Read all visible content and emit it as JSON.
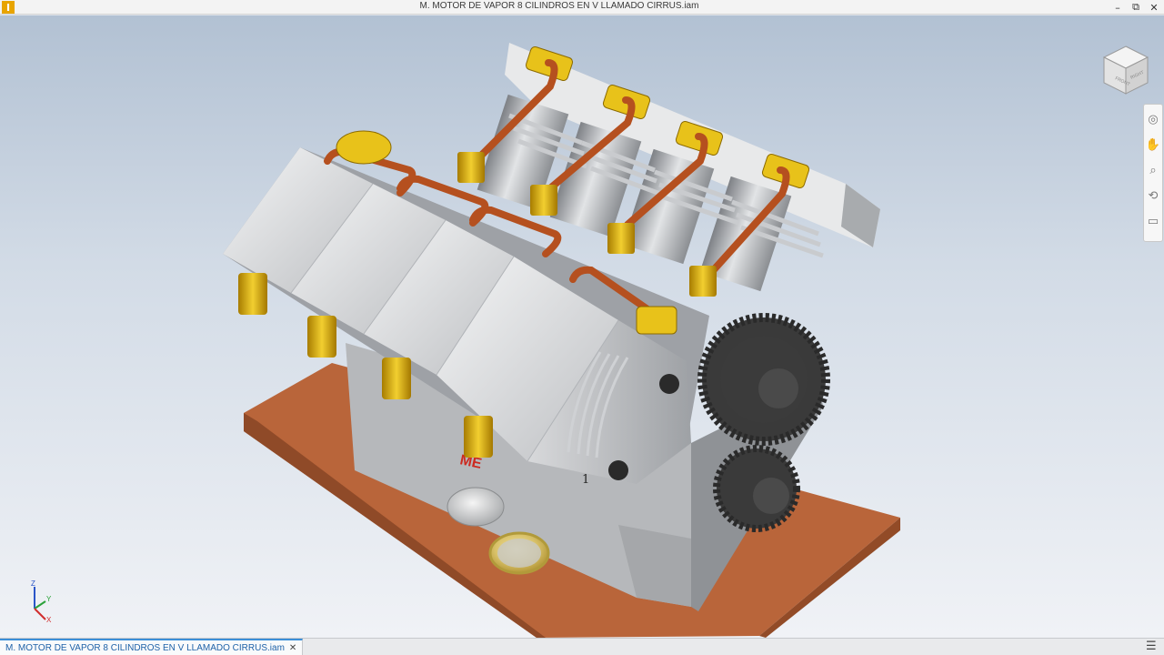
{
  "app": {
    "icon_letter": "I",
    "window_title": "M. MOTOR DE VAPOR 8 CILINDROS EN V LLAMADO CIRRUS.iam",
    "window_buttons": {
      "minimize": "–",
      "restore": "⧉",
      "close": "✕"
    }
  },
  "viewport": {
    "model_name": "M. MOTOR DE VAPOR 8 CILINDROS EN V LLAMADO CIRRUS.iam",
    "callout_number": "1",
    "engraving_text": "ME",
    "colors": {
      "background_top": "#b2c1d3",
      "background_bottom": "#f0f2f6",
      "base_plate": "#b9653a",
      "brass": "#e0b40a",
      "copper_pipe": "#b5501f",
      "aluminum": "#d4d6d8",
      "gear": "#3a3a3a",
      "engraving": "#cc2a20"
    }
  },
  "viewcube": {
    "faces": {
      "top": "",
      "front": "FRONT",
      "right": "RIGHT"
    },
    "icon": "viewcube-icon"
  },
  "navbar": {
    "tools": [
      {
        "name": "steering-wheel",
        "glyph": "◎"
      },
      {
        "name": "pan",
        "glyph": "✋"
      },
      {
        "name": "zoom",
        "glyph": "⌕"
      },
      {
        "name": "orbit",
        "glyph": "⟲"
      },
      {
        "name": "look-at",
        "glyph": "▭"
      }
    ]
  },
  "triad": {
    "z": "Z",
    "y": "Y",
    "x": "X"
  },
  "tabs": {
    "documents": [
      {
        "label": "M. MOTOR DE VAPOR 8 CILINDROS EN V LLAMADO CIRRUS.iam",
        "close": "✕"
      }
    ],
    "menu_glyph": "☰"
  }
}
